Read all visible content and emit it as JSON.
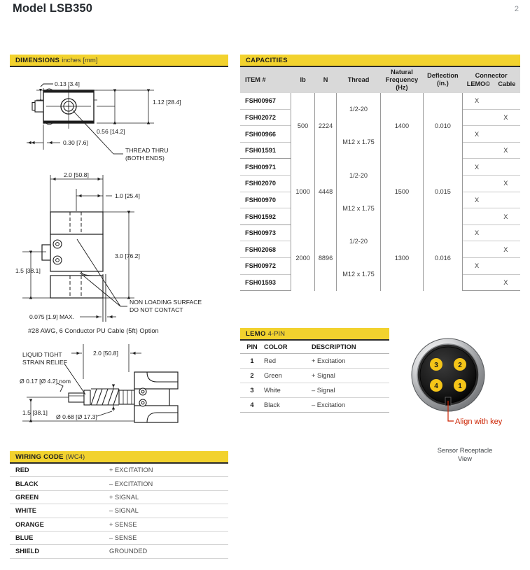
{
  "header": {
    "title": "Model LSB350",
    "page_number": "2"
  },
  "sections": {
    "dimensions": {
      "strong": "DIMENSIONS",
      "light": "inches [mm]"
    },
    "capacities": {
      "strong": "CAPACITIES",
      "light": ""
    },
    "lemo": {
      "strong": "LEMO",
      "light": "4-PIN"
    },
    "wiring": {
      "strong": "WIRING CODE",
      "light": "(WC4)"
    }
  },
  "capacities": {
    "columns": {
      "item": "ITEM #",
      "lb": "lb",
      "n": "N",
      "thread": "Thread",
      "natural_frequency": "Natural Frequency (Hz)",
      "natural_frequency_l1": "Natural",
      "natural_frequency_l2": "Frequency",
      "natural_frequency_l3": "(Hz)",
      "deflection_l1": "Deflection",
      "deflection_l2": "(in.)",
      "connector": "Connector",
      "connector_lemo": "LEMO©",
      "connector_cable": "Cable"
    },
    "mark": "X",
    "groups": [
      {
        "lb": "500",
        "n": "2224",
        "natural_frequency": "1400",
        "deflection": "0.010",
        "threads": [
          {
            "label": "1/2-20",
            "rows": [
              {
                "item": "FSH00967",
                "lemo": "X",
                "cable": ""
              },
              {
                "item": "FSH02072",
                "lemo": "",
                "cable": "X"
              }
            ]
          },
          {
            "label": "M12 x 1.75",
            "rows": [
              {
                "item": "FSH00966",
                "lemo": "X",
                "cable": ""
              },
              {
                "item": "FSH01591",
                "lemo": "",
                "cable": "X"
              }
            ]
          }
        ]
      },
      {
        "lb": "1000",
        "n": "4448",
        "natural_frequency": "1500",
        "deflection": "0.015",
        "threads": [
          {
            "label": "1/2-20",
            "rows": [
              {
                "item": "FSH00971",
                "lemo": "X",
                "cable": ""
              },
              {
                "item": "FSH02070",
                "lemo": "",
                "cable": "X"
              }
            ]
          },
          {
            "label": "M12 x 1.75",
            "rows": [
              {
                "item": "FSH00970",
                "lemo": "X",
                "cable": ""
              },
              {
                "item": "FSH01592",
                "lemo": "",
                "cable": "X"
              }
            ]
          }
        ]
      },
      {
        "lb": "2000",
        "n": "8896",
        "natural_frequency": "1300",
        "deflection": "0.016",
        "threads": [
          {
            "label": "1/2-20",
            "rows": [
              {
                "item": "FSH00973",
                "lemo": "X",
                "cable": ""
              },
              {
                "item": "FSH02068",
                "lemo": "",
                "cable": "X"
              }
            ]
          },
          {
            "label": "M12 x 1.75",
            "rows": [
              {
                "item": "FSH00972",
                "lemo": "X",
                "cable": ""
              },
              {
                "item": "FSH01593",
                "lemo": "",
                "cable": "X"
              }
            ]
          }
        ]
      }
    ]
  },
  "lemo_table": {
    "columns": {
      "pin": "PIN",
      "color": "COLOR",
      "description": "DESCRIPTION"
    },
    "rows": [
      {
        "pin": "1",
        "color": "Red",
        "description": "+ Excitation"
      },
      {
        "pin": "2",
        "color": "Green",
        "description": "+ Signal"
      },
      {
        "pin": "3",
        "color": "White",
        "description": "– Signal"
      },
      {
        "pin": "4",
        "color": "Black",
        "description": "– Excitation"
      }
    ]
  },
  "connector_figure": {
    "pins": [
      {
        "number": "3",
        "position": "top-left"
      },
      {
        "number": "2",
        "position": "top-right"
      },
      {
        "number": "4",
        "position": "bottom-left"
      },
      {
        "number": "1",
        "position": "bottom-right"
      }
    ],
    "key_label": "Align with key",
    "caption_line1": "Sensor Receptacle",
    "caption_line2": "View",
    "colors": {
      "outer_ring": "#c9cacc",
      "body": "#1a1a1a",
      "pin": "#F5C518",
      "key_label": "#cc2200"
    }
  },
  "wiring_code": {
    "rows": [
      {
        "name": "RED",
        "desc": "+ EXCITATION"
      },
      {
        "name": "BLACK",
        "desc": "– EXCITATION"
      },
      {
        "name": "GREEN",
        "desc": "+ SIGNAL"
      },
      {
        "name": "WHITE",
        "desc": "– SIGNAL"
      },
      {
        "name": "ORANGE",
        "desc": "+ SENSE"
      },
      {
        "name": "BLUE",
        "desc": "– SENSE"
      },
      {
        "name": "SHIELD",
        "desc": "GROUNDED"
      }
    ]
  },
  "drawings": {
    "top_view": {
      "dim_thickness": "0.13 [3.4]",
      "dim_height": "1.12 [28.4]",
      "dim_mid": "0.56 [14.2]",
      "dim_offset": "0.30 [7.6]",
      "note_line1": "THREAD THRU",
      "note_line2": "(BOTH ENDS)"
    },
    "front_view": {
      "dim_width": "2.0 [50.8]",
      "dim_inner": "1.0 [25.4]",
      "dim_height": "3.0 [76.2]",
      "dim_base": "1.5 [38.1]",
      "dim_gap": "0.075 [1.9] MAX.",
      "note_line1": "NON LOADING SURFACE",
      "note_line2": "DO NOT CONTACT"
    },
    "cable_view": {
      "title": "#28 AWG, 6 Conductor PU Cable (5ft) Option",
      "strain_line1": "LIQUID TIGHT",
      "strain_line2": "STRAIN RELIEF",
      "dim_cable": "Ø 0.17 [Ø 4.2] nom",
      "dim_width": "2.0 [50.8]",
      "dim_boot": "Ø 0.68 [Ø 17.3]",
      "dim_height": "1.5 [38.1]"
    }
  },
  "colors": {
    "accent_yellow": "#F2D22E",
    "table_header_gray": "#D9D9D9",
    "text_dark": "#1d1d1d"
  }
}
